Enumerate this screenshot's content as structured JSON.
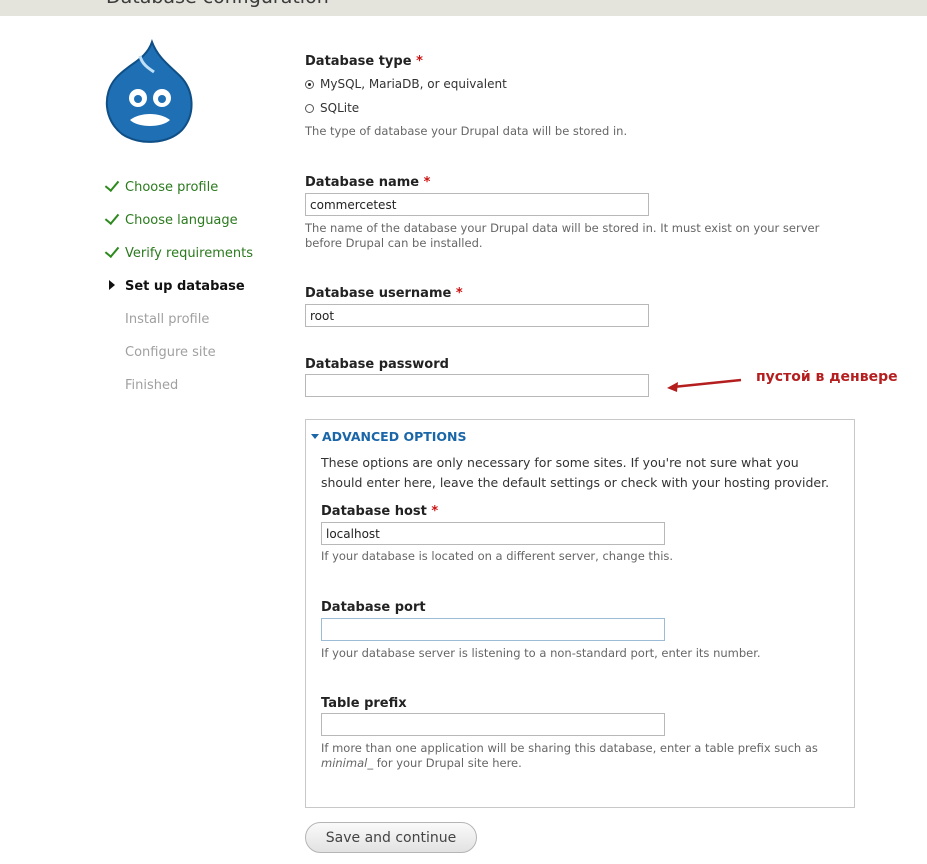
{
  "header": {
    "title": "Database configuration"
  },
  "steps": [
    {
      "label": "Choose profile",
      "state": "done"
    },
    {
      "label": "Choose language",
      "state": "done"
    },
    {
      "label": "Verify requirements",
      "state": "done"
    },
    {
      "label": "Set up database",
      "state": "active"
    },
    {
      "label": "Install profile",
      "state": "future"
    },
    {
      "label": "Configure site",
      "state": "future"
    },
    {
      "label": "Finished",
      "state": "future"
    }
  ],
  "form": {
    "db_type": {
      "label": "Database type",
      "required_mark": "*",
      "options": [
        "MySQL, MariaDB, or equivalent",
        "SQLite"
      ],
      "selected": "MySQL, MariaDB, or equivalent",
      "description": "The type of database your Drupal data will be stored in."
    },
    "db_name": {
      "label": "Database name",
      "required_mark": "*",
      "value": "commercetest",
      "description": "The name of the database your Drupal data will be stored in. It must exist on your server before Drupal can be installed."
    },
    "db_username": {
      "label": "Database username",
      "required_mark": "*",
      "value": "root"
    },
    "db_password": {
      "label": "Database password",
      "value": ""
    },
    "advanced": {
      "legend": "ADVANCED OPTIONS",
      "intro": "These options are only necessary for some sites. If you're not sure what you should enter here, leave the default settings or check with your hosting provider.",
      "host": {
        "label": "Database host",
        "required_mark": "*",
        "value": "localhost",
        "description": "If your database is located on a different server, change this."
      },
      "port": {
        "label": "Database port",
        "value": "",
        "description": "If your database server is listening to a non-standard port, enter its number."
      },
      "prefix": {
        "label": "Table prefix",
        "value": "",
        "description_before": "If more than one application will be sharing this database, enter a table prefix such as ",
        "description_em": "minimal_",
        "description_after": " for your Drupal site here."
      }
    },
    "submit_label": "Save and continue"
  },
  "annotation": {
    "text": "пустой в денвере",
    "color": "#b51e1e"
  },
  "colors": {
    "accent": "#1a66a8",
    "done": "#2a7a1d",
    "required": "#cc1111",
    "drupal_blue": "#1f6fb4"
  },
  "icons": {
    "logo": "drupal-drop-logo",
    "done": "checkmark-icon",
    "active": "triangle-right-icon",
    "legend": "triangle-down-icon"
  }
}
